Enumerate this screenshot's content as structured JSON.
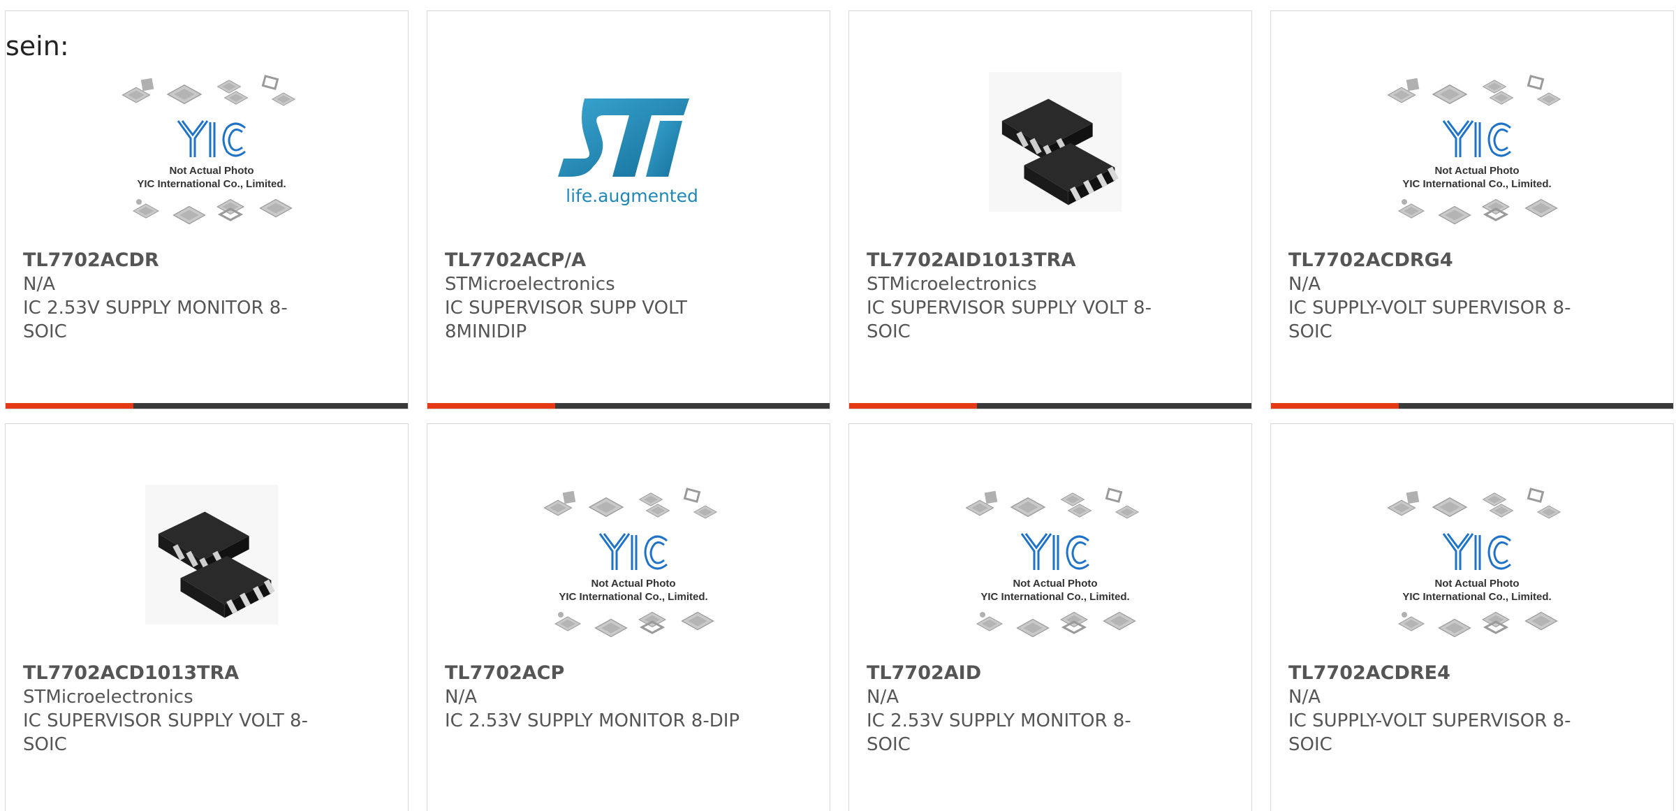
{
  "heading_fragment": "sein:",
  "placeholder_image": {
    "line1": "Not Actual Photo",
    "line2": "YIC International Co., Limited."
  },
  "st_logo": {
    "tagline": "life.augmented"
  },
  "colors": {
    "accent": "#e63a17",
    "bar_dark": "#3a3a3a",
    "st_blue": "#1f88b8",
    "yic_blue": "#1e73c8",
    "text": "#555555"
  },
  "products": [
    {
      "part_number": "TL7702ACDR",
      "manufacturer": "N/A",
      "description": "IC 2.53V SUPPLY MONITOR 8-SOIC",
      "image": "yic-placeholder"
    },
    {
      "part_number": "TL7702ACP/A",
      "manufacturer": "STMicroelectronics",
      "description": "IC SUPERVISOR SUPP VOLT 8MINIDIP",
      "image": "st-logo"
    },
    {
      "part_number": "TL7702AID1013TRA",
      "manufacturer": "STMicroelectronics",
      "description": "IC SUPERVISOR SUPPLY VOLT 8-SOIC",
      "image": "soic-chip-photo"
    },
    {
      "part_number": "TL7702ACDRG4",
      "manufacturer": "N/A",
      "description": "IC SUPPLY-VOLT SUPERVISOR 8-SOIC",
      "image": "yic-placeholder"
    },
    {
      "part_number": "TL7702ACD1013TRA",
      "manufacturer": "STMicroelectronics",
      "description": "IC SUPERVISOR SUPPLY VOLT 8-SOIC",
      "image": "soic-chip-photo"
    },
    {
      "part_number": "TL7702ACP",
      "manufacturer": "N/A",
      "description": "IC 2.53V SUPPLY MONITOR 8-DIP",
      "image": "yic-placeholder"
    },
    {
      "part_number": "TL7702AID",
      "manufacturer": "N/A",
      "description": "IC 2.53V SUPPLY MONITOR 8-SOIC",
      "image": "yic-placeholder"
    },
    {
      "part_number": "TL7702ACDRE4",
      "manufacturer": "N/A",
      "description": "IC SUPPLY-VOLT SUPERVISOR 8-SOIC",
      "image": "yic-placeholder"
    }
  ]
}
